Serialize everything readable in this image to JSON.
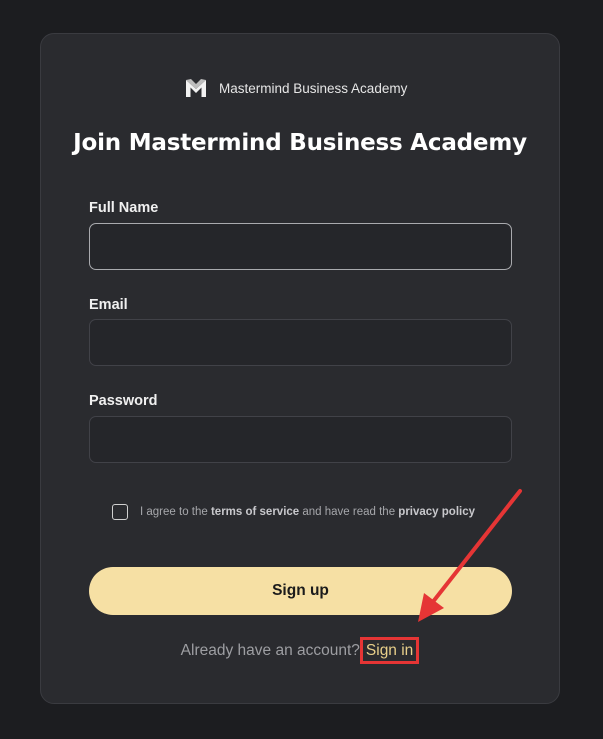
{
  "brand": {
    "logo_icon": "m-monogram-logo",
    "name": "Mastermind Business Academy"
  },
  "title": "Join Mastermind Business Academy",
  "fields": {
    "full_name": {
      "label": "Full Name",
      "value": "",
      "placeholder": ""
    },
    "email": {
      "label": "Email",
      "value": "",
      "placeholder": ""
    },
    "password": {
      "label": "Password",
      "value": "",
      "placeholder": ""
    }
  },
  "agreement": {
    "checked": false,
    "prefix": "I agree to the ",
    "terms_label": "terms of service",
    "middle": " and have read the ",
    "privacy_label": "privacy policy"
  },
  "signup_button_label": "Sign up",
  "footer": {
    "prompt": "Already have an account?",
    "signin_label": "Sign in"
  },
  "colors": {
    "background": "#1c1d20",
    "card": "#2a2b2f",
    "accent_button": "#f6e0a4",
    "link": "#e8cf8a",
    "annotation": "#e53535"
  }
}
